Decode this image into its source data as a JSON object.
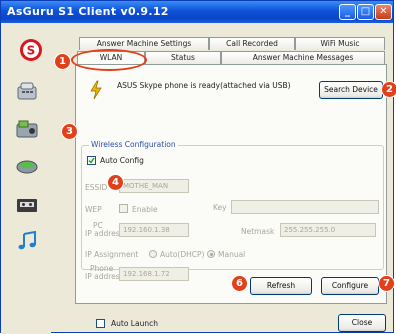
{
  "window": {
    "title": "AsGuru S1 Client v0.9.12"
  },
  "tabs_top": [
    "Answer Machine Settings",
    "Call Recorded",
    "WiFi Music"
  ],
  "tabs_bottom": [
    "WLAN",
    "Status",
    "Answer Machine Messages"
  ],
  "status_message": "ASUS Skype phone is ready(attached via USB)",
  "buttons": {
    "search_device": "Search Device",
    "refresh": "Refresh",
    "configure": "Configure",
    "close": "Close"
  },
  "wireless": {
    "group_label": "Wireless Configuration",
    "auto_config_label": "Auto Config",
    "auto_config_checked": true,
    "essid_label": "ESSID",
    "essid_value": "MOTHE_MAN",
    "wep_label": "WEP",
    "enable_label": "Enable",
    "key_label": "Key",
    "key_value": "",
    "pc_ip_label_1": "PC",
    "pc_ip_label_2": "IP address",
    "pc_ip_value": "192.160.1.38",
    "netmask_label": "Netmask",
    "netmask_value": "255.255.255.0",
    "ip_assignment_label": "IP Assignment",
    "auto_dhcp_label": "Auto(DHCP)",
    "manual_label": "Manual",
    "phone_ip_label_1": "Phone",
    "phone_ip_label_2": "IP address",
    "phone_ip_value": "192.168.1.72"
  },
  "auto_launch_label": "Auto Launch",
  "callouts": [
    "1",
    "2",
    "3",
    "4",
    "6",
    "7"
  ],
  "sidebar_icons": [
    "skype-logo-icon",
    "phone-icon",
    "answer-machine-icon",
    "call-record-icon",
    "wifi-router-icon",
    "cassette-icon",
    "music-note-icon"
  ],
  "colors": {
    "callout": "#e2401a",
    "titlebar": "#0d52d9"
  }
}
